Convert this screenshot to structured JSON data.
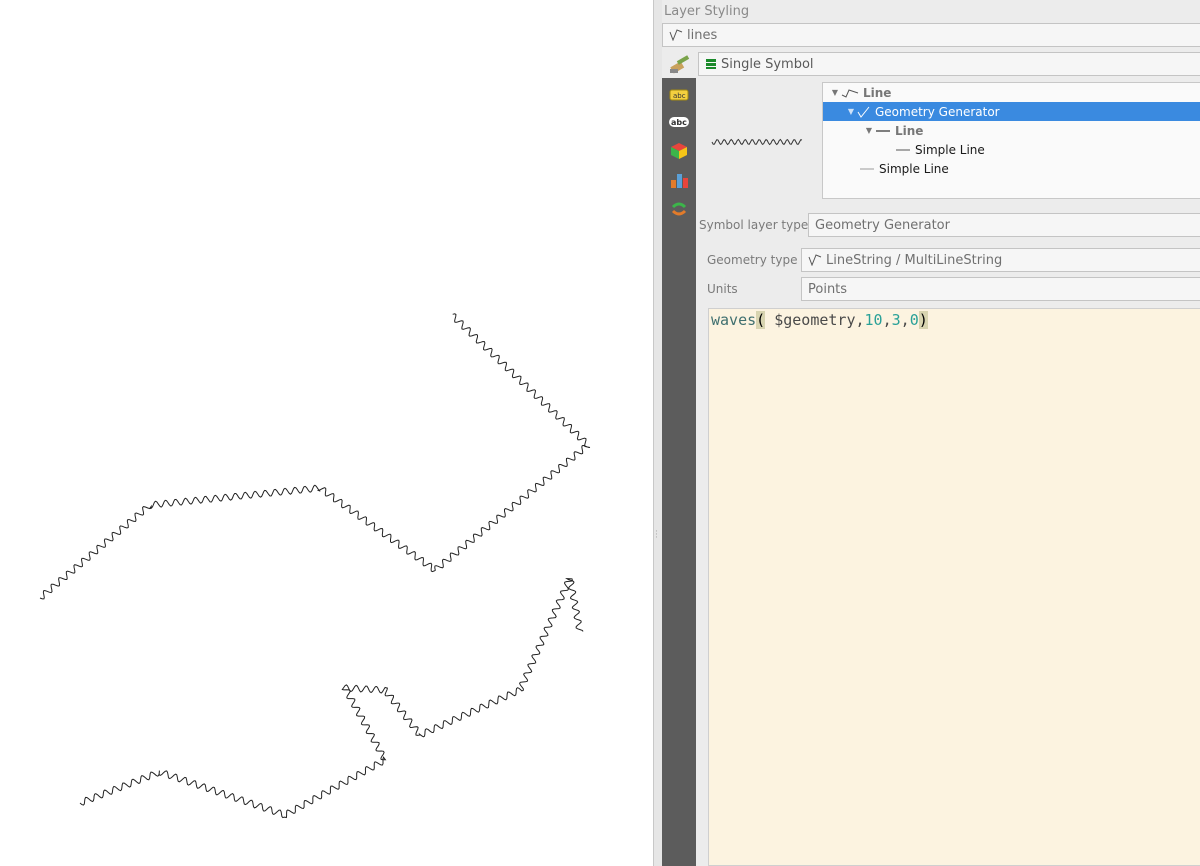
{
  "panel": {
    "title": "Layer Styling",
    "layer_name": "lines",
    "renderer": "Single Symbol"
  },
  "symbol_tree": [
    {
      "label": "Line",
      "bold": true,
      "selected": false,
      "icon": "line-symbol-icon"
    },
    {
      "label": "Geometry Generator",
      "bold": false,
      "selected": true,
      "icon": "geometry-generator-icon"
    },
    {
      "label": "Line",
      "bold": true,
      "selected": false,
      "icon": "line-icon"
    },
    {
      "label": "Simple Line",
      "bold": false,
      "selected": false,
      "icon": "simple-line-icon"
    },
    {
      "label": "Simple Line",
      "bold": false,
      "selected": false,
      "icon": "simple-line-icon"
    }
  ],
  "fields": {
    "symbol_layer_type_label": "Symbol layer type",
    "symbol_layer_type_value": "Geometry Generator",
    "geometry_type_label": "Geometry type",
    "geometry_type_value": "LineString / MultiLineString",
    "units_label": "Units",
    "units_value": "Points"
  },
  "expression": {
    "function": "waves",
    "open_paren": "(",
    "arg_geometry": " $geometry",
    "comma1": ",",
    "arg1": "10",
    "comma2": ",",
    "arg2": "3",
    "comma3": ",",
    "arg3": "0",
    "close_paren": ")"
  },
  "sidebar_icons": [
    "labels-icon",
    "abc-labels-icon",
    "3d-view-icon",
    "diagrams-icon",
    "history-icon"
  ],
  "colors": {
    "selection": "#3a8ae0",
    "editor_bg": "#fcf3e0",
    "sidebar_bg": "#5c5c5c",
    "number": "#2aa198"
  }
}
